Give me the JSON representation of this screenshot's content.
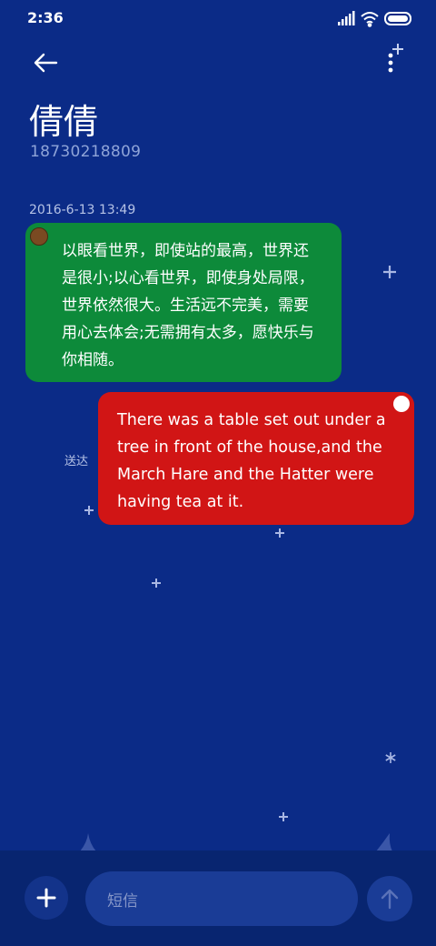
{
  "status_bar": {
    "time": "2:36"
  },
  "header": {
    "back_icon": "arrow-left-icon",
    "more_icon": "more-vertical-icon",
    "contact_name": "倩倩",
    "contact_number": "18730218809"
  },
  "conversation": {
    "timestamp": "2016-6-13 13:49",
    "messages": [
      {
        "direction": "incoming",
        "text": "以眼看世界，即使站的最高，世界还是很小;以心看世界，即使身处局限，世界依然很大。生活远不完美，需要用心去体会;无需拥有太多，愿快乐与你相随。",
        "color": "#0d8a3a"
      },
      {
        "direction": "outgoing",
        "text": "There was a table set out under a tree in front of the house,and the March Hare and the Hatter were having tea at it.",
        "color": "#d11515",
        "status": "送达"
      }
    ]
  },
  "composer": {
    "add_icon": "plus-icon",
    "placeholder": "短信",
    "send_icon": "arrow-up-icon"
  },
  "colors": {
    "background": "#0b2b87",
    "incoming_bubble": "#0d8a3a",
    "outgoing_bubble": "#d11515",
    "input_background": "#1a3c96"
  }
}
